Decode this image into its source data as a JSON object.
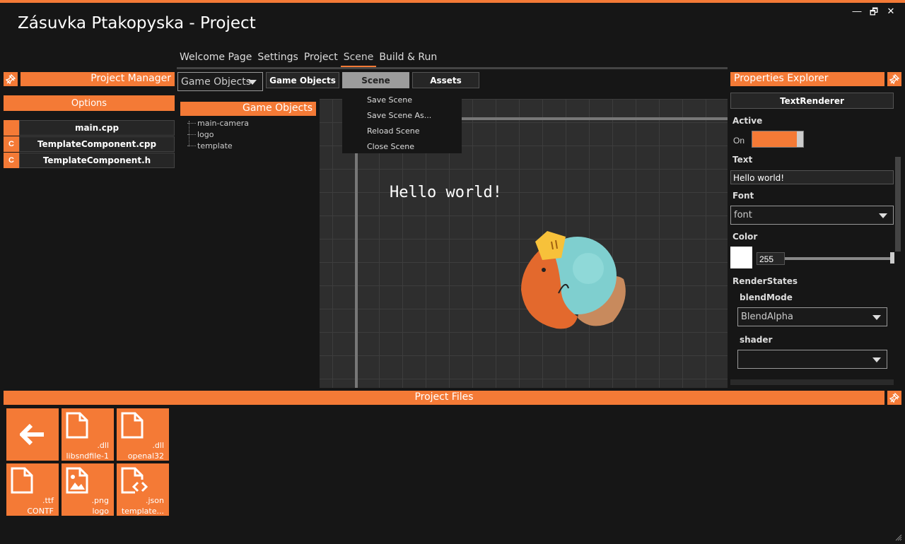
{
  "window": {
    "title": "Zásuvka Ptakopyska - Project",
    "minimize_glyph": "—",
    "restore_glyph": "🗗",
    "close_glyph": "✕"
  },
  "menu": {
    "items": [
      {
        "label": "Welcome Page"
      },
      {
        "label": "Settings"
      },
      {
        "label": "Project"
      },
      {
        "label": "Scene"
      },
      {
        "label": "Build & Run"
      }
    ],
    "active": "Scene"
  },
  "project_manager": {
    "title": "Project Manager",
    "options_label": "Options",
    "files": [
      {
        "lang": "",
        "name": "main.cpp"
      },
      {
        "lang": "C",
        "name": "TemplateComponent.cpp"
      },
      {
        "lang": "C",
        "name": "TemplateComponent.h"
      }
    ]
  },
  "toolbar": {
    "view_select": "Game Objects",
    "tabs": [
      {
        "label": "Game Objects"
      },
      {
        "label": "Scene"
      },
      {
        "label": "Assets"
      }
    ]
  },
  "scene_menu": {
    "items": [
      {
        "label": "Save Scene"
      },
      {
        "label": "Save Scene As..."
      },
      {
        "label": "Reload Scene"
      },
      {
        "label": "Close Scene"
      }
    ]
  },
  "game_objects": {
    "title": "Game Objects",
    "items": [
      {
        "label": "main-camera"
      },
      {
        "label": "logo"
      },
      {
        "label": "template"
      }
    ]
  },
  "viewport": {
    "text": "Hello world!"
  },
  "properties": {
    "title": "Properties Explorer",
    "component": "TextRenderer",
    "active_label": "Active",
    "active_value": "On",
    "text_label": "Text",
    "text_value": "Hello world!",
    "font_label": "Font",
    "font_value": "font",
    "color_label": "Color",
    "color_value": "255",
    "color_slider": 1.0,
    "render_states_label": "RenderStates",
    "blend_mode_label": "blendMode",
    "blend_mode_value": "BlendAlpha",
    "shader_label": "shader",
    "shader_value": ""
  },
  "project_files": {
    "title": "Project Files",
    "items": [
      {
        "ext": "",
        "name": "",
        "icon": "back-arrow-icon"
      },
      {
        "ext": ".dll",
        "name": "libsndfile-1",
        "icon": "file-icon"
      },
      {
        "ext": ".dll",
        "name": "openal32",
        "icon": "file-icon"
      },
      {
        "ext": ".ttf",
        "name": "CONTF",
        "icon": "file-icon"
      },
      {
        "ext": ".png",
        "name": "logo",
        "icon": "image-file-icon"
      },
      {
        "ext": ".json",
        "name": "template...",
        "icon": "code-file-icon"
      }
    ]
  },
  "colors": {
    "accent": "#f47a36",
    "background": "#161616",
    "panel": "#262626"
  }
}
